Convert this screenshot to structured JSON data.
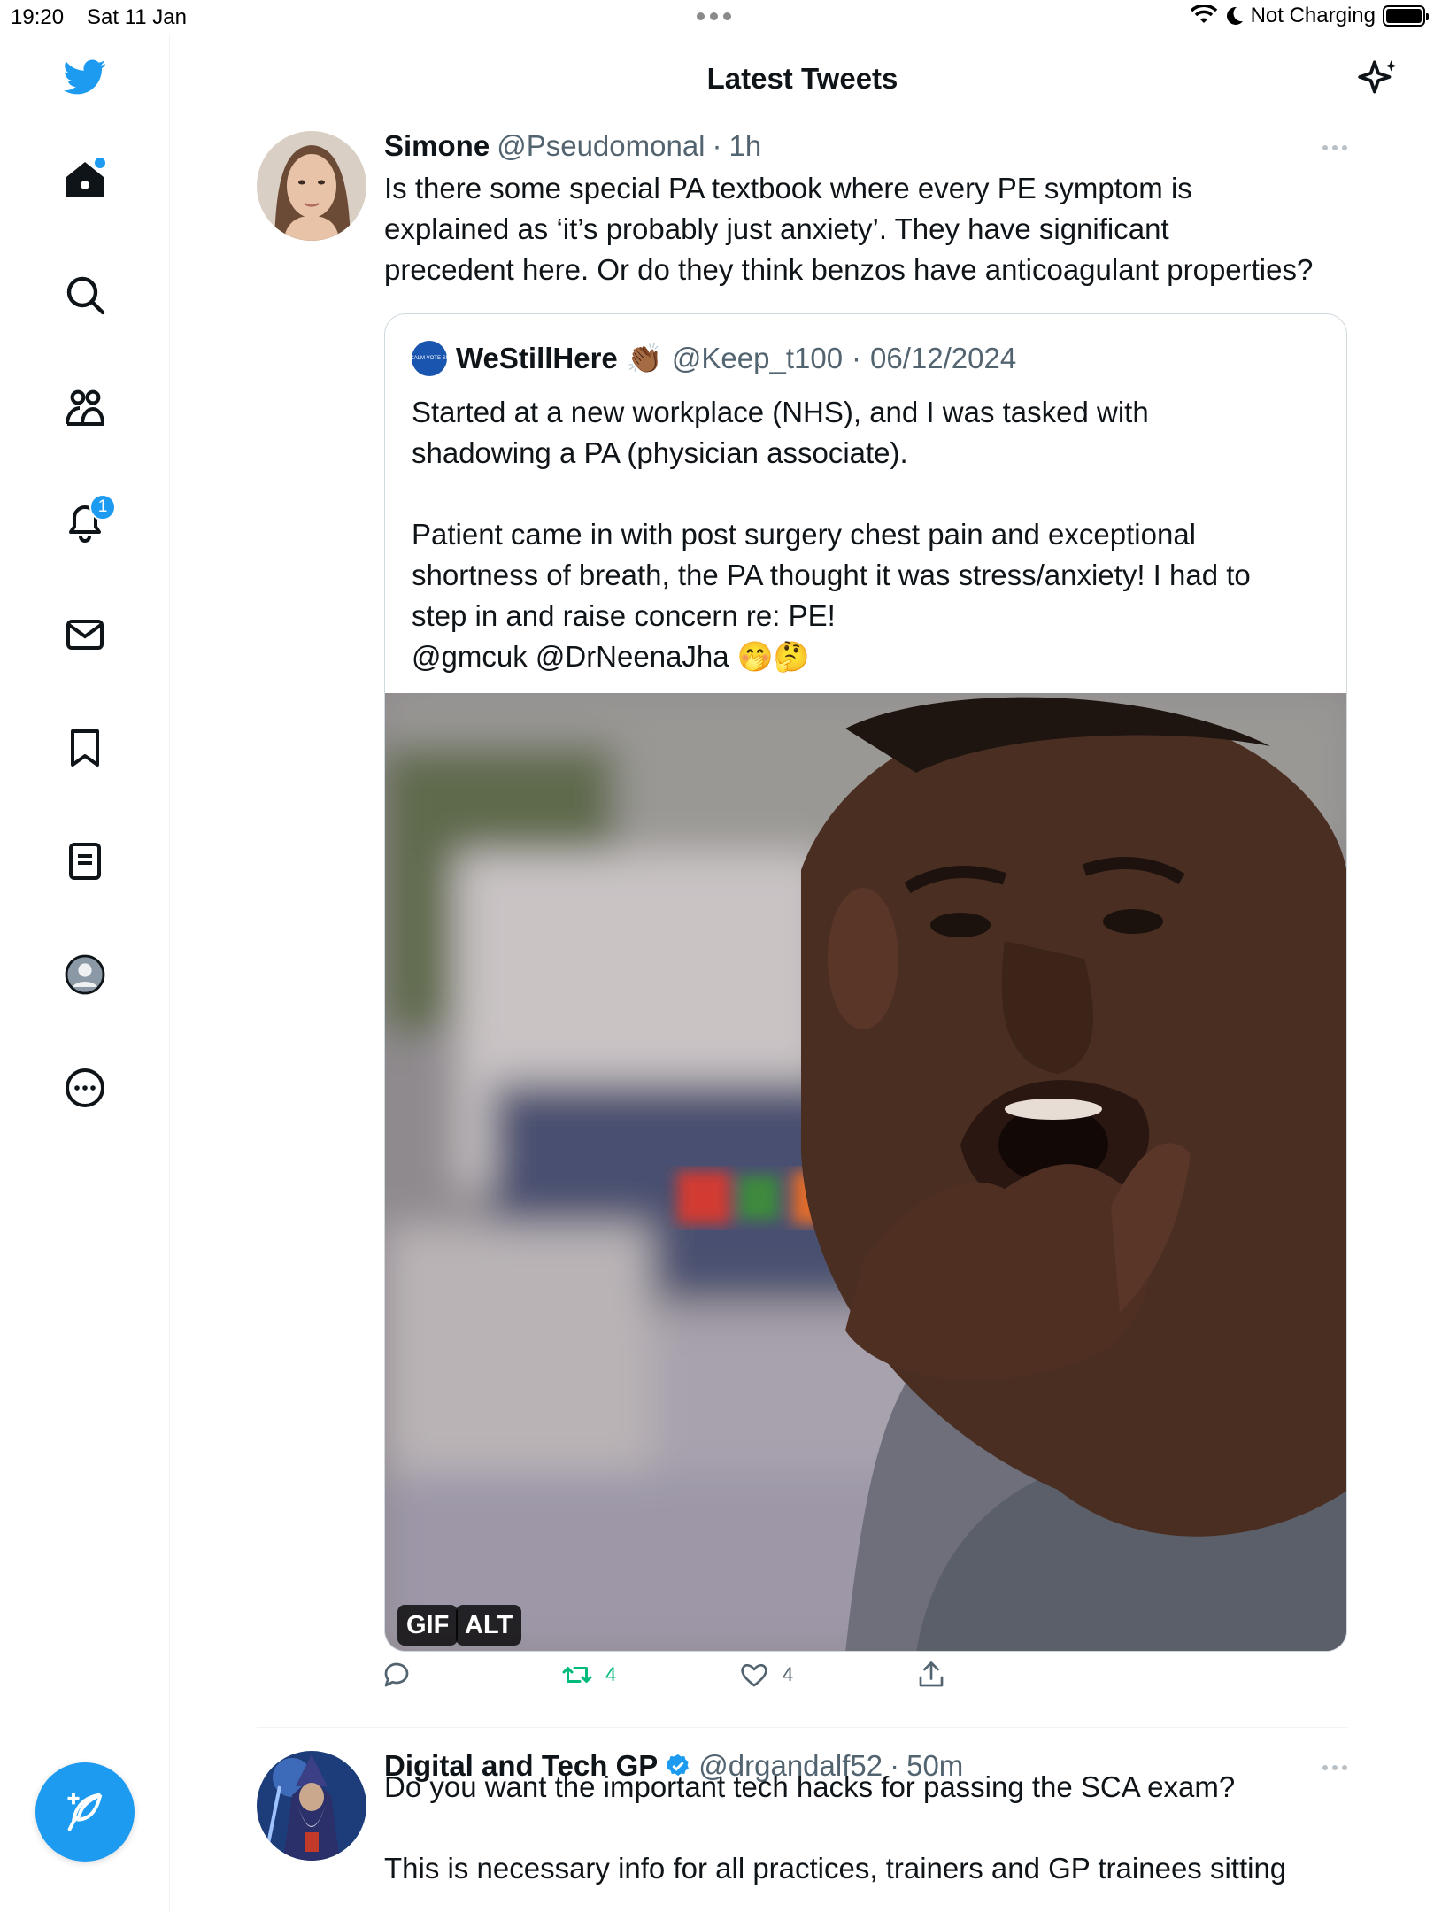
{
  "status_bar": {
    "time": "19:20",
    "date": "Sat 11 Jan",
    "charging": "Not Charging",
    "icons": [
      "wifi-icon",
      "moon-icon",
      "battery-icon"
    ]
  },
  "sidebar": {
    "items": [
      {
        "name": "home",
        "icon": "home-icon"
      },
      {
        "name": "search",
        "icon": "search-icon"
      },
      {
        "name": "communities",
        "icon": "people-icon"
      },
      {
        "name": "notifications",
        "icon": "bell-icon",
        "badge": "1"
      },
      {
        "name": "messages",
        "icon": "envelope-icon"
      },
      {
        "name": "bookmarks",
        "icon": "bookmark-icon"
      },
      {
        "name": "lists",
        "icon": "list-icon"
      },
      {
        "name": "profile",
        "icon": "avatar-icon"
      },
      {
        "name": "more",
        "icon": "more-circle-icon"
      }
    ]
  },
  "header": {
    "title": "Latest Tweets"
  },
  "tweets": [
    {
      "name": "Simone",
      "handle": "@Pseudomonal",
      "time": "1h",
      "text": "Is there some special PA textbook where every PE symptom is\nexplained as ‘it’s probably just anxiety’. They have significant\nprecedent here. Or do they think benzos have anticoagulant properties?",
      "quote": {
        "avatar_text": "KEEP CALM VOTE SPENCE",
        "name": "WeStillHere",
        "emoji": "👏🏾",
        "handle": "@Keep_t100",
        "date": "06/12/2024",
        "text": "Started at a new workplace (NHS), and I was tasked with\nshadowing a PA (physician associate).\n\nPatient came in with post surgery chest pain and exceptional\nshortness of breath, the PA thought it was stress/anxiety! I had to\nstep in and raise concern re: PE!\n@gmcuk @DrNeenaJha 🤭🤔",
        "media_tags": [
          "GIF",
          "ALT"
        ]
      },
      "actions": {
        "reply": "",
        "retweets": "4",
        "likes": "4"
      }
    },
    {
      "name": "Digital and Tech GP",
      "handle": "@drgandalf52",
      "time": "50m",
      "text": "Do you want the important tech hacks for passing the SCA exam?\n\nThis is necessary info for all practices, trainers and GP trainees sitting"
    }
  ],
  "colors": {
    "accent": "#1d9bf0",
    "retweet": "#00ba7c",
    "secondary_text": "#536471"
  }
}
